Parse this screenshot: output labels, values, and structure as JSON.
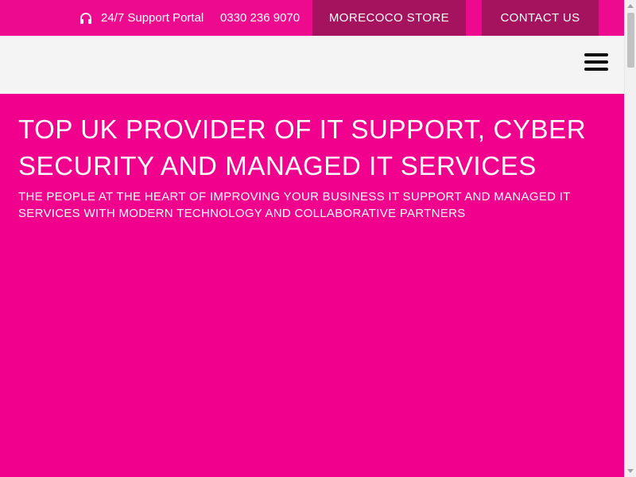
{
  "topbar": {
    "support_label": "24/7 Support Portal",
    "support_icon": "headphones-icon",
    "phone": "0330 236 9070",
    "store_label": "MORECOCO STORE",
    "contact_label": "CONTACT US"
  },
  "header": {
    "menu_icon": "hamburger-menu-icon"
  },
  "hero": {
    "title": "TOP UK PROVIDER OF IT SUPPORT, CYBER SECURITY AND MANAGED IT SERVICES",
    "subtitle": "THE PEOPLE AT THE HEART OF IMPROVING YOUR BUSINESS IT SUPPORT AND MANAGED IT SERVICES WITH MODERN TECHNOLOGY AND COLLABORATIVE PARTNERS"
  },
  "colors": {
    "topbar_bg": "#ee0a8e",
    "button_bg": "#a5125e",
    "header_bg": "#f4f4f4",
    "hero_bg": "#f0008c",
    "text_light": "#ffffff"
  }
}
